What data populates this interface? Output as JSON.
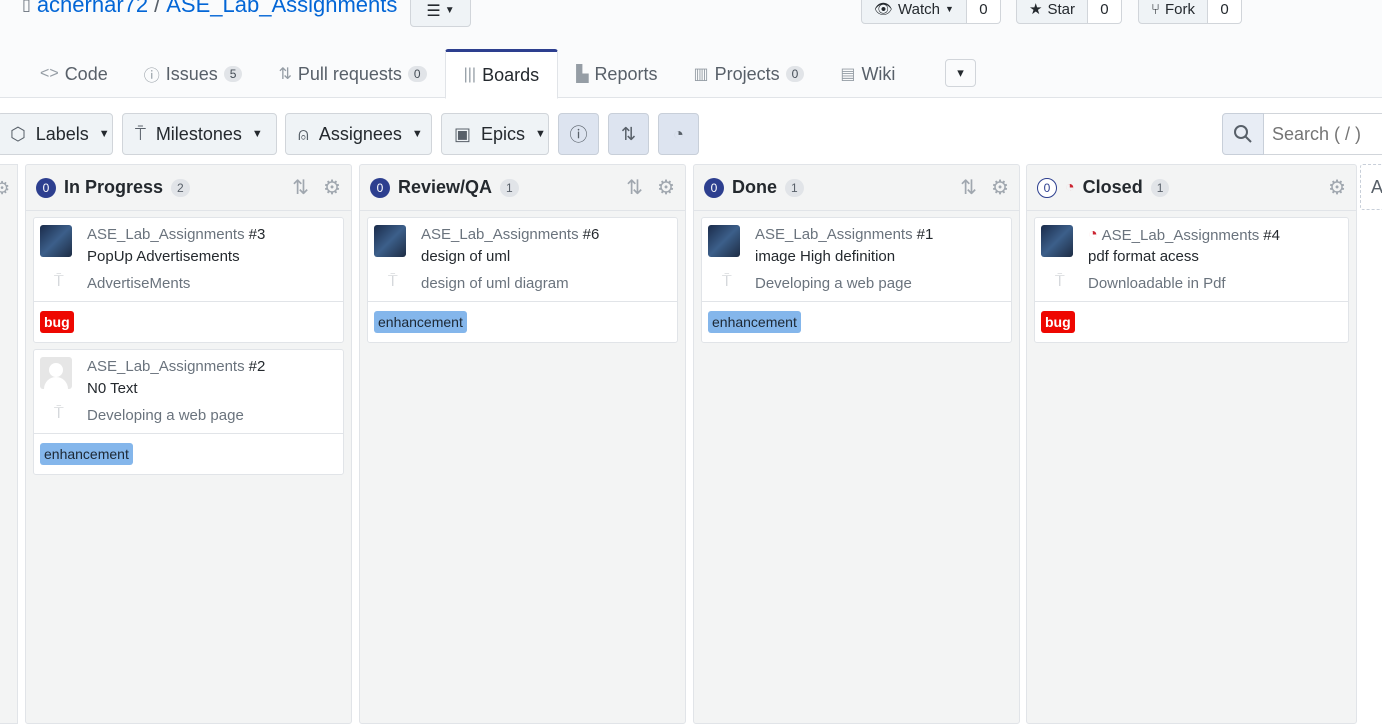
{
  "repo": {
    "owner": "achernar72",
    "separator": "/",
    "name": "ASE_Lab_Assignments"
  },
  "social": {
    "watch": {
      "label": "Watch",
      "count": "0"
    },
    "star": {
      "label": "Star",
      "count": "0"
    },
    "fork": {
      "label": "Fork",
      "count": "0"
    }
  },
  "tabs": [
    {
      "label": "Code",
      "icon": "code-icon"
    },
    {
      "label": "Issues",
      "count": "5",
      "icon": "issue-icon"
    },
    {
      "label": "Pull requests",
      "count": "0",
      "icon": "pull-request-icon"
    },
    {
      "label": "Boards",
      "icon": "boards-icon",
      "active": true
    },
    {
      "label": "Reports",
      "icon": "graph-icon"
    },
    {
      "label": "Projects",
      "count": "0",
      "icon": "project-icon"
    },
    {
      "label": "Wiki",
      "icon": "book-icon"
    }
  ],
  "filters": {
    "labels": "Labels",
    "milestones": "Milestones",
    "assignees": "Assignees",
    "epics": "Epics",
    "search_placeholder": "Search ( / )"
  },
  "columns": [
    {
      "title": "In Progress",
      "badge": "0",
      "count": "2",
      "cards": [
        {
          "repo": "ASE_Lab_Assignments",
          "number": "#3",
          "title": "PopUp Advertisements",
          "milestone": "AdvertiseMents",
          "label": "bug",
          "label_type": "bug"
        },
        {
          "repo": "ASE_Lab_Assignments",
          "number": "#2",
          "title": "N0 Text",
          "milestone": "Developing a web page",
          "label": "enhancement",
          "label_type": "enh"
        }
      ]
    },
    {
      "title": "Review/QA",
      "badge": "0",
      "count": "1",
      "cards": [
        {
          "repo": "ASE_Lab_Assignments",
          "number": "#6",
          "title": "design of uml",
          "milestone": "design of uml diagram",
          "label": "enhancement",
          "label_type": "enh"
        }
      ]
    },
    {
      "title": "Done",
      "badge": "0",
      "count": "1",
      "cards": [
        {
          "repo": "ASE_Lab_Assignments",
          "number": "#1",
          "title": "image High definition",
          "milestone": "Developing a web page",
          "label": "enhancement",
          "label_type": "enh"
        }
      ]
    },
    {
      "title": "Closed",
      "badge": "0",
      "count": "1",
      "cards": [
        {
          "repo": "ASE_Lab_Assignments",
          "number": "#4",
          "title": "pdf format acess",
          "milestone": "Downloadable in Pdf",
          "label": "bug",
          "label_type": "bug"
        }
      ]
    }
  ],
  "add_column_label": "A",
  "colors": {
    "accent": "#2d3f8f",
    "bug": "#ee0701",
    "enhancement": "#84b6eb",
    "link": "#0366d6"
  }
}
